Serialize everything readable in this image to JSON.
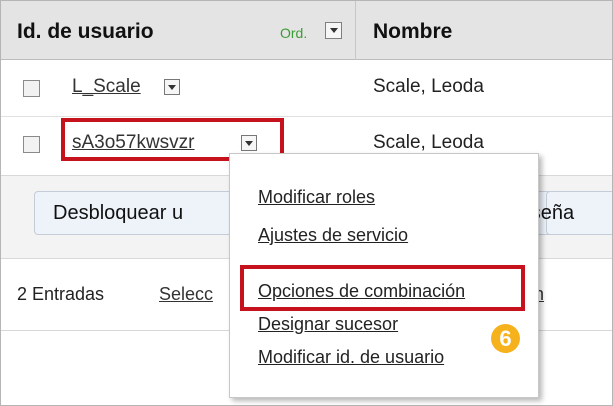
{
  "header": {
    "col_user_id": "Id. de usuario",
    "sort_label": "Ord.",
    "col_name": "Nombre"
  },
  "rows": [
    {
      "user_id": "L_Scale",
      "name": "Scale, Leoda"
    },
    {
      "user_id": "sA3o57kwsvzr",
      "name": "Scale, Leoda"
    }
  ],
  "buttons": {
    "unlock_partial": "Desbloquear u",
    "password_partial": "raseña"
  },
  "footer": {
    "entries_count": "2 Entradas",
    "select_partial": "Selecc",
    "action_partial": "ción"
  },
  "context_menu": {
    "items": [
      "Modificar roles",
      "Ajustes de servicio",
      "Opciones de combinación",
      "Designar sucesor",
      "Modificar id. de usuario"
    ]
  },
  "callout": {
    "number": "6"
  },
  "colors": {
    "highlight": "#c5121d",
    "callout": "#f6b21c",
    "sort_label": "#3d9b35"
  }
}
